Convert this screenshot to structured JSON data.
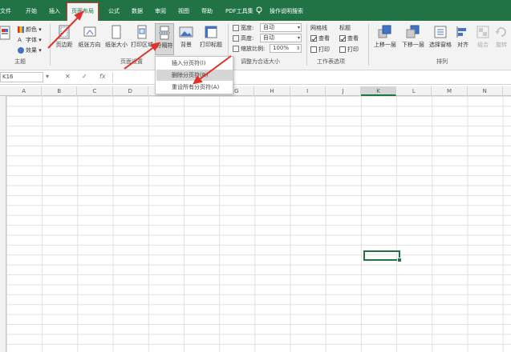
{
  "tabs": [
    {
      "label": "文件",
      "active": false
    },
    {
      "label": "开始",
      "active": false
    },
    {
      "label": "插入",
      "active": false
    },
    {
      "label": "页面布局",
      "active": true
    },
    {
      "label": "公式",
      "active": false
    },
    {
      "label": "数据",
      "active": false
    },
    {
      "label": "审阅",
      "active": false
    },
    {
      "label": "视图",
      "active": false
    },
    {
      "label": "帮助",
      "active": false
    },
    {
      "label": "PDF工具集",
      "active": false
    }
  ],
  "tell_me": "操作说明搜索",
  "ribbon": {
    "theme_items": [
      "颜色",
      "字体",
      "效果"
    ],
    "theme_group": "主题",
    "page_setup_buttons": [
      "页边距",
      "纸张方向",
      "纸张大小",
      "打印区域",
      "分隔符",
      "背景",
      "打印标题"
    ],
    "page_setup_group": "页面设置",
    "scale": {
      "width_label": "宽度:",
      "width_value": "自动",
      "height_label": "高度:",
      "height_value": "自动",
      "scale_label": "缩放比例:",
      "scale_value": "100%",
      "group": "调整为合适大小"
    },
    "sheet_options": {
      "gridlines": "网格线",
      "headings": "标题",
      "view": "查看",
      "print": "打印",
      "gridlines_view": true,
      "gridlines_print": false,
      "headings_view": true,
      "headings_print": false,
      "group": "工作表选项"
    },
    "arrange": {
      "buttons": [
        "上移一层",
        "下移一层",
        "选择窗格",
        "对齐",
        "组合",
        "旋转"
      ],
      "group": "排列"
    }
  },
  "breaks_menu": {
    "items": [
      "插入分页符(I)",
      "删除分页符(R)",
      "重设所有分页符(A)"
    ],
    "highlighted_index": 1
  },
  "formula_bar": {
    "name_box": "K16",
    "cancel": "✕",
    "enter": "✓",
    "fx": "fx"
  },
  "columns": [
    "A",
    "B",
    "C",
    "D",
    "E",
    "F",
    "G",
    "H",
    "I",
    "J",
    "K",
    "L",
    "M",
    "N"
  ],
  "selected_column": "K",
  "colors": {
    "brand": "#217346",
    "annotation": "#e0312b"
  }
}
